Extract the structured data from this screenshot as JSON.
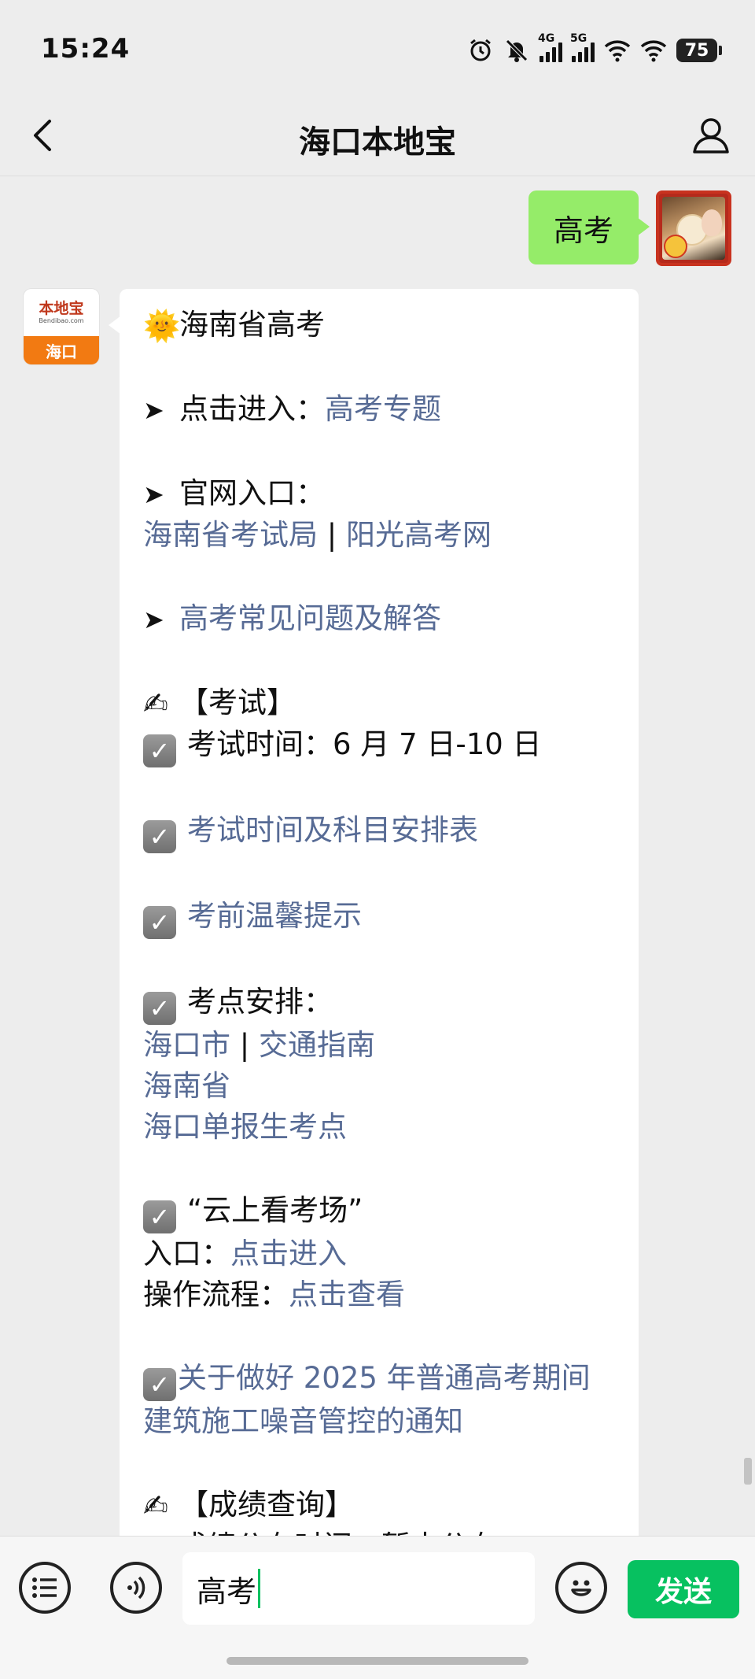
{
  "status_bar": {
    "time": "15:24",
    "network_1": "4G",
    "network_2": "5G",
    "battery": "75",
    "icons": [
      "alarm-icon",
      "mute-icon",
      "signal-icon",
      "signal-icon",
      "wifi-icon",
      "wifi-icon",
      "battery-icon"
    ]
  },
  "header": {
    "title": "海口本地宝",
    "back_icon": "chevron-left-icon",
    "profile_icon": "person-icon"
  },
  "chat": {
    "outgoing": {
      "text": "高考"
    },
    "bot": {
      "avatar_brand": "本地宝",
      "avatar_domain": "Bendibao.com",
      "avatar_city": "海口",
      "title": "海南省高考",
      "topic_prefix": "点击进入：",
      "topic_link": "高考专题",
      "official_label": "官网入口：",
      "official_links": [
        "海南省考试局",
        "阳光高考网"
      ],
      "separator": "|",
      "faq_link": "高考常见问题及解答",
      "exam_section": "【考试】",
      "exam_time": "考试时间：6 月 7 日-10 日",
      "schedule_link": "考试时间及科目安排表",
      "tips_link": "考前温馨提示",
      "venue_label": "考点安排：",
      "venue_haikou": "海口市",
      "venue_traffic": "交通指南",
      "venue_hainan": "海南省",
      "venue_single": "海口单报生考点",
      "cloud_title": "“云上看考场”",
      "cloud_entry_label": "入口：",
      "cloud_entry_link": "点击进入",
      "cloud_process_label": "操作流程：",
      "cloud_process_link": "点击查看",
      "notice_line1": "关于做好 2025 年普通高考期间",
      "notice_line2": "建筑施工噪音管控的通知",
      "score_section": "【成绩查询】",
      "score_time": "成绩公布时间：暂未公布"
    }
  },
  "input_bar": {
    "value": "高考",
    "send_label": "发送"
  },
  "colors": {
    "background": "#ededed",
    "outgoing_bubble": "#95ec69",
    "link": "#576b95",
    "send_button": "#07c160",
    "bot_city_badge": "#f27a12"
  }
}
